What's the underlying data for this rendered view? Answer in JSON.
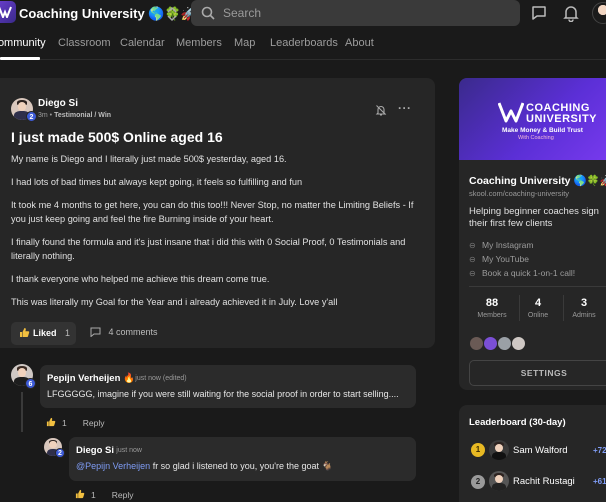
{
  "header": {
    "app_title": "Coaching University 🌎🍀🚀",
    "search_placeholder": "Search"
  },
  "nav": {
    "tabs": [
      {
        "label": "Community"
      },
      {
        "label": "Classroom"
      },
      {
        "label": "Calendar"
      },
      {
        "label": "Members"
      },
      {
        "label": "Map"
      },
      {
        "label": "Leaderboards"
      },
      {
        "label": "About"
      }
    ]
  },
  "post": {
    "author": "Diego Si",
    "author_level": "2",
    "time": "3m",
    "category": "Testimonial / Win",
    "title": "I just made 500$ Online aged 16",
    "paragraphs": [
      "My name is Diego and I literally just made 500$ yesterday, aged 16.",
      "I had lots of bad times but always kept going, it feels so fulfilling and fun",
      "It took me 4 months to get here, you can do this too!!! Never Stop, no matter the Limiting Beliefs - If you just keep going and feel the fire Burning inside of your heart.",
      "I finally found the formula and it's just insane that i did this with 0 Social Proof, 0 Testimonials and literally nothing.",
      "I thank everyone who helped me achieve this dream come true.",
      "This was literally my Goal for the Year and i already achieved it in July. Love y'all"
    ],
    "liked_label": "Liked",
    "like_count": "1",
    "comments_label": "4 comments"
  },
  "comments": [
    {
      "author": "Pepijn Verheijen",
      "author_suffix": "🔥",
      "level": "6",
      "meta": "· just now (edited)",
      "text": "LFGGGGG, imagine if you were still waiting for the social proof in order to start selling....",
      "like_count": "1",
      "reply_label": "Reply"
    },
    {
      "author": "Diego Si",
      "level": "2",
      "meta": "· just now",
      "mention": "@Pepijn Verheijen",
      "text": " fr so glad i listened to you, you're the goat 🐐",
      "like_count": "1",
      "reply_label": "Reply"
    }
  ],
  "sidebar": {
    "banner": {
      "line1": "COACHING",
      "line2": "UNIVERSITY",
      "line3": "Make Money & Build Trust",
      "line4": "With Coaching"
    },
    "group_name": "Coaching University 🌎🍀🚀",
    "group_url": "skool.com/coaching-university",
    "description": "Helping beginner coaches sign their first few clients",
    "links": [
      {
        "label": "My Instagram"
      },
      {
        "label": "My YouTube"
      },
      {
        "label": "Book a quick 1-on-1 call!"
      }
    ],
    "stats": [
      {
        "value": "88",
        "label": "Members"
      },
      {
        "value": "4",
        "label": "Online"
      },
      {
        "value": "3",
        "label": "Admins"
      }
    ],
    "settings_label": "SETTINGS"
  },
  "leaderboard": {
    "title": "Leaderboard (30-day)",
    "entries": [
      {
        "rank": "1",
        "name": "Sam Walford",
        "points": "+72"
      },
      {
        "rank": "2",
        "name": "Rachit Rustagi",
        "points": "+61"
      }
    ]
  },
  "colors": {
    "background": "#1a1a1a",
    "card": "#262626",
    "accent_blue": "#7f9cf5",
    "level_badge": "#3d5bd8",
    "banner_purple": "#5b2fd6",
    "rank_gold": "#e8b923"
  }
}
